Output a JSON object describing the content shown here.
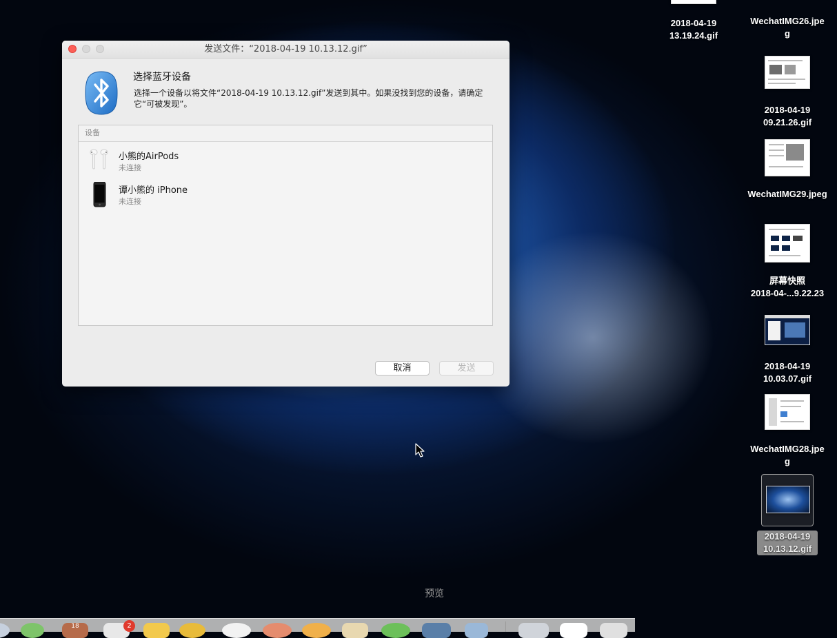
{
  "window": {
    "title": "发送文件：“2018-04-19 10.13.12.gif”",
    "heading": "选择蓝牙设备",
    "description": "选择一个设备以将文件“2018-04-19 10.13.12.gif”发送到其中。如果没找到您的设备，请确定它“可被发现”。",
    "list_header": "设备",
    "devices": [
      {
        "name": "小熊的AirPods",
        "status": "未连接",
        "icon": "airpods-icon"
      },
      {
        "name": "谭小熊的 iPhone",
        "status": "未连接",
        "icon": "iphone-icon"
      }
    ],
    "cancel_label": "取消",
    "send_label": "发送",
    "icon": "bluetooth-icon"
  },
  "desktop": {
    "icons": [
      {
        "label": "2018-04-19\n13.19.24.gif"
      },
      {
        "label": "WechatIMG26.jpe\ng"
      },
      {
        "label": "2018-04-19\n09.21.26.gif"
      },
      {
        "label": "WechatIMG29.jpeg"
      },
      {
        "label": "屏幕快照\n2018-04-...9.22.23"
      },
      {
        "label": "2018-04-19\n10.03.07.gif"
      },
      {
        "label": "WechatIMG28.jpe\ng"
      },
      {
        "label": "2018-04-19\n10.13.12.gif",
        "selected": true
      }
    ]
  },
  "dock": {
    "tooltip": "预览",
    "badge_count": "2",
    "calendar_day": "18"
  },
  "colors": {
    "close_button": "#fc5f57",
    "bluetooth_blue": "#2f86d8",
    "selection": "#8a8a8a"
  }
}
